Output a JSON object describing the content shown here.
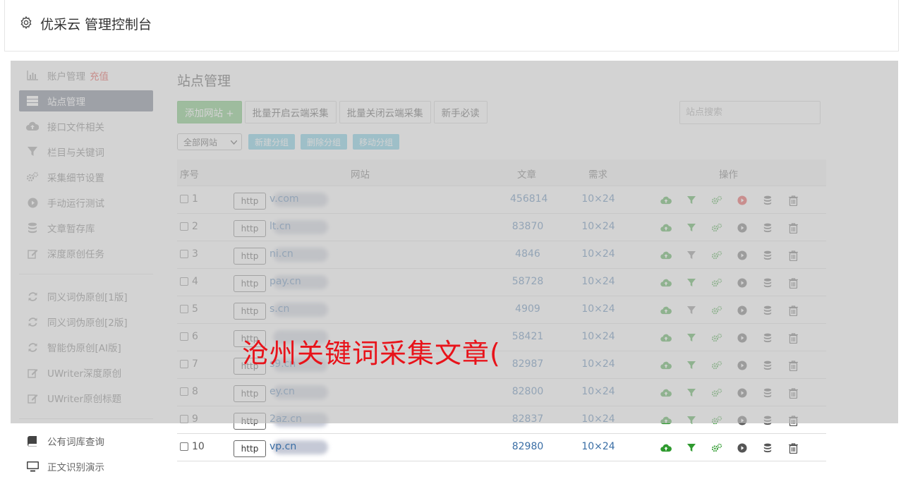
{
  "header": {
    "title": "优采云 管理控制台"
  },
  "sidebar": {
    "items": [
      {
        "label": "账户管理",
        "extra": "充值",
        "icon": "bar-chart-icon"
      },
      {
        "label": "站点管理",
        "icon": "server-icon",
        "active": true
      },
      {
        "label": "接口文件相关",
        "icon": "cloud-upload-icon"
      },
      {
        "label": "栏目与关键词",
        "icon": "filter-icon"
      },
      {
        "label": "采集细节设置",
        "icon": "gears-icon"
      },
      {
        "label": "手动运行测试",
        "icon": "play-circle-icon"
      },
      {
        "label": "文章暂存库",
        "icon": "database-icon"
      },
      {
        "label": "深度原创任务",
        "icon": "edit-icon"
      }
    ],
    "items2": [
      {
        "label": "同义词伪原创[1版]",
        "icon": "refresh-icon"
      },
      {
        "label": "同义词伪原创[2版]",
        "icon": "refresh-icon"
      },
      {
        "label": "智能伪原创[AI版]",
        "icon": "refresh-icon"
      },
      {
        "label": "UWriter深度原创",
        "icon": "edit-icon"
      },
      {
        "label": "UWriter原创标题",
        "icon": "edit-icon"
      }
    ],
    "items3": [
      {
        "label": "公有词库查询",
        "icon": "book-icon"
      },
      {
        "label": "正文识别演示",
        "icon": "monitor-icon"
      }
    ]
  },
  "main": {
    "title": "站点管理",
    "buttons": {
      "add": "添加网站 +",
      "batch_open": "批量开启云端采集",
      "batch_close": "批量关闭云端采集",
      "guide": "新手必读"
    },
    "search_placeholder": "站点搜索",
    "group_select": "全部网站",
    "group_buttons": {
      "new": "新建分组",
      "delete": "删除分组",
      "move": "移动分组"
    },
    "columns": {
      "no": "序号",
      "site": "网站",
      "articles": "文章",
      "demand": "需求",
      "ops": "操作"
    },
    "http_label": "http",
    "rows": [
      {
        "no": "1",
        "site": "v.com",
        "articles": "456814",
        "demand": "10×24",
        "run_active": true
      },
      {
        "no": "2",
        "site": "lt.cn",
        "articles": "83870",
        "demand": "10×24",
        "run_active": false
      },
      {
        "no": "3",
        "site": "ni.cn",
        "articles": "4846",
        "demand": "10×24",
        "run_active": false
      },
      {
        "no": "4",
        "site": "pay.cn",
        "articles": "58728",
        "demand": "10×24",
        "run_active": false
      },
      {
        "no": "5",
        "site": "s.cn",
        "articles": "4909",
        "demand": "10×24",
        "run_active": false
      },
      {
        "no": "6",
        "site": "",
        "articles": "58421",
        "demand": "10×24",
        "run_active": false
      },
      {
        "no": "7",
        "site": "s9.cn",
        "articles": "82987",
        "demand": "10×24",
        "run_active": false
      },
      {
        "no": "8",
        "site": "ey.cn",
        "articles": "82800",
        "demand": "10×24",
        "run_active": false
      },
      {
        "no": "9",
        "site": "2az.cn",
        "articles": "82837",
        "demand": "10×24",
        "run_active": false
      },
      {
        "no": "10",
        "site": "vp.cn",
        "articles": "82980",
        "demand": "10×24",
        "run_active": false
      }
    ]
  },
  "watermark": "沧州关键词采集文章(",
  "colors": {
    "green": "#2e9a2e",
    "red": "#e02a2a",
    "link": "#3a6ea5",
    "active_nav": "#5a6478"
  }
}
